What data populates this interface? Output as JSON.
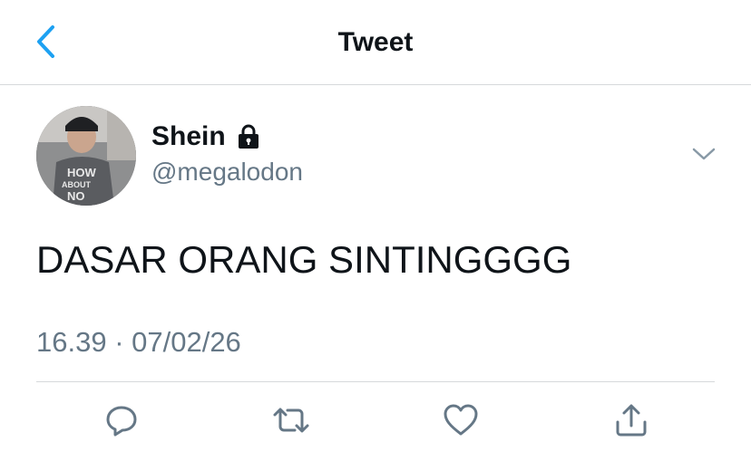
{
  "header": {
    "title": "Tweet",
    "back_icon": "chevron-left-icon",
    "accent_color": "#1da1f2"
  },
  "tweet": {
    "display_name": "Shein",
    "protected_icon": "lock-icon",
    "handle": "@megalodon",
    "text": "DASAR ORANG SINTINGGGG",
    "timestamp": "16.39 · 07/02/26",
    "avatar": {
      "shirt_text": [
        "HOW",
        "ABOUT",
        "NO"
      ]
    }
  },
  "actions": [
    {
      "name": "reply",
      "icon": "reply-icon"
    },
    {
      "name": "retweet",
      "icon": "retweet-icon"
    },
    {
      "name": "like",
      "icon": "heart-icon"
    },
    {
      "name": "share",
      "icon": "share-icon"
    }
  ],
  "colors": {
    "text": "#0f1419",
    "secondary": "#657786",
    "divider": "#d6d9db"
  }
}
